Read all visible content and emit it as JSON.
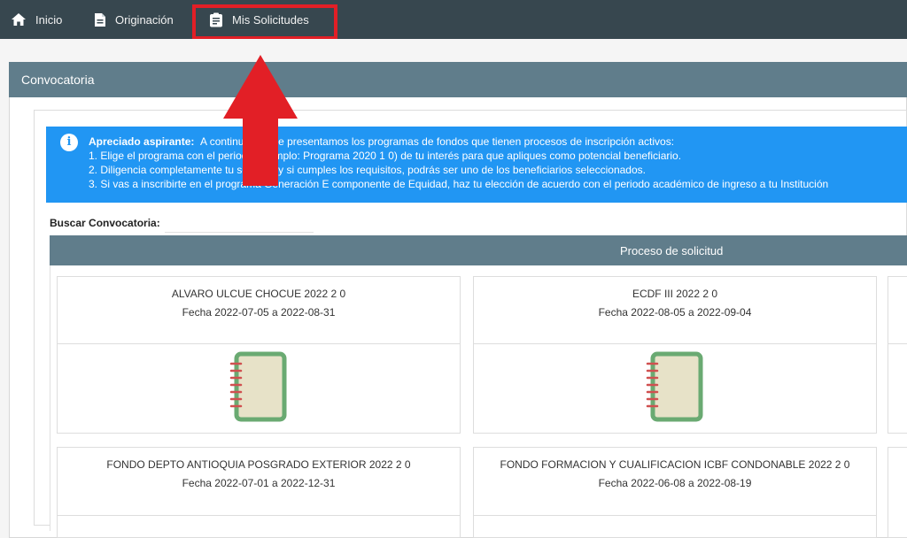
{
  "nav": {
    "items": [
      {
        "label": "Inicio",
        "icon": "home-icon"
      },
      {
        "label": "Originación",
        "icon": "document-icon"
      },
      {
        "label": "Mis Solicitudes",
        "icon": "clipboard-icon"
      }
    ]
  },
  "panel": {
    "title": "Convocatoria"
  },
  "alert": {
    "lead": "Apreciado aspirante:",
    "intro": "A continuación, te presentamos los programas de fondos que tienen procesos de inscripción activos:",
    "items": [
      "1. Elige el programa con el periodo (ejemplo: Programa 2020 1 0) de tu interés para que apliques como potencial beneficiario.",
      "2. Diligencia completamente tu solicitud y si cumples los requisitos, podrás ser uno de los beneficiarios seleccionados.",
      "3. Si vas a inscribirte en el programa Generación E componente de Equidad, haz tu elección de acuerdo con el periodo académico de ingreso a tu Institución"
    ]
  },
  "search": {
    "label": "Buscar Convocatoria:",
    "value": ""
  },
  "process": {
    "header": "Proceso de solicitud"
  },
  "cards": [
    {
      "name": "ALVARO ULCUE CHOCUE 2022 2 0",
      "dates": "Fecha 2022-07-05 a 2022-08-31"
    },
    {
      "name": "ECDF III 2022 2 0",
      "dates": "Fecha 2022-08-05 a 2022-09-04"
    },
    {
      "name": "FONDO DEPTO ANTIOQUIA POSGRADO EXTERIOR 2022 2 0",
      "dates": "Fecha 2022-07-01 a 2022-12-31"
    },
    {
      "name": "FONDO FORMACION Y CUALIFICACION ICBF CONDONABLE 2022 2 0",
      "dates": "Fecha 2022-06-08 a 2022-08-19"
    }
  ],
  "colors": {
    "topbar": "#37474f",
    "panel_header": "#607d8b",
    "alert": "#2196f3",
    "highlight": "#e21f26",
    "notebook_fill": "#e7e2c8",
    "notebook_border": "#6aaa72",
    "notebook_rings": "#d05050"
  }
}
